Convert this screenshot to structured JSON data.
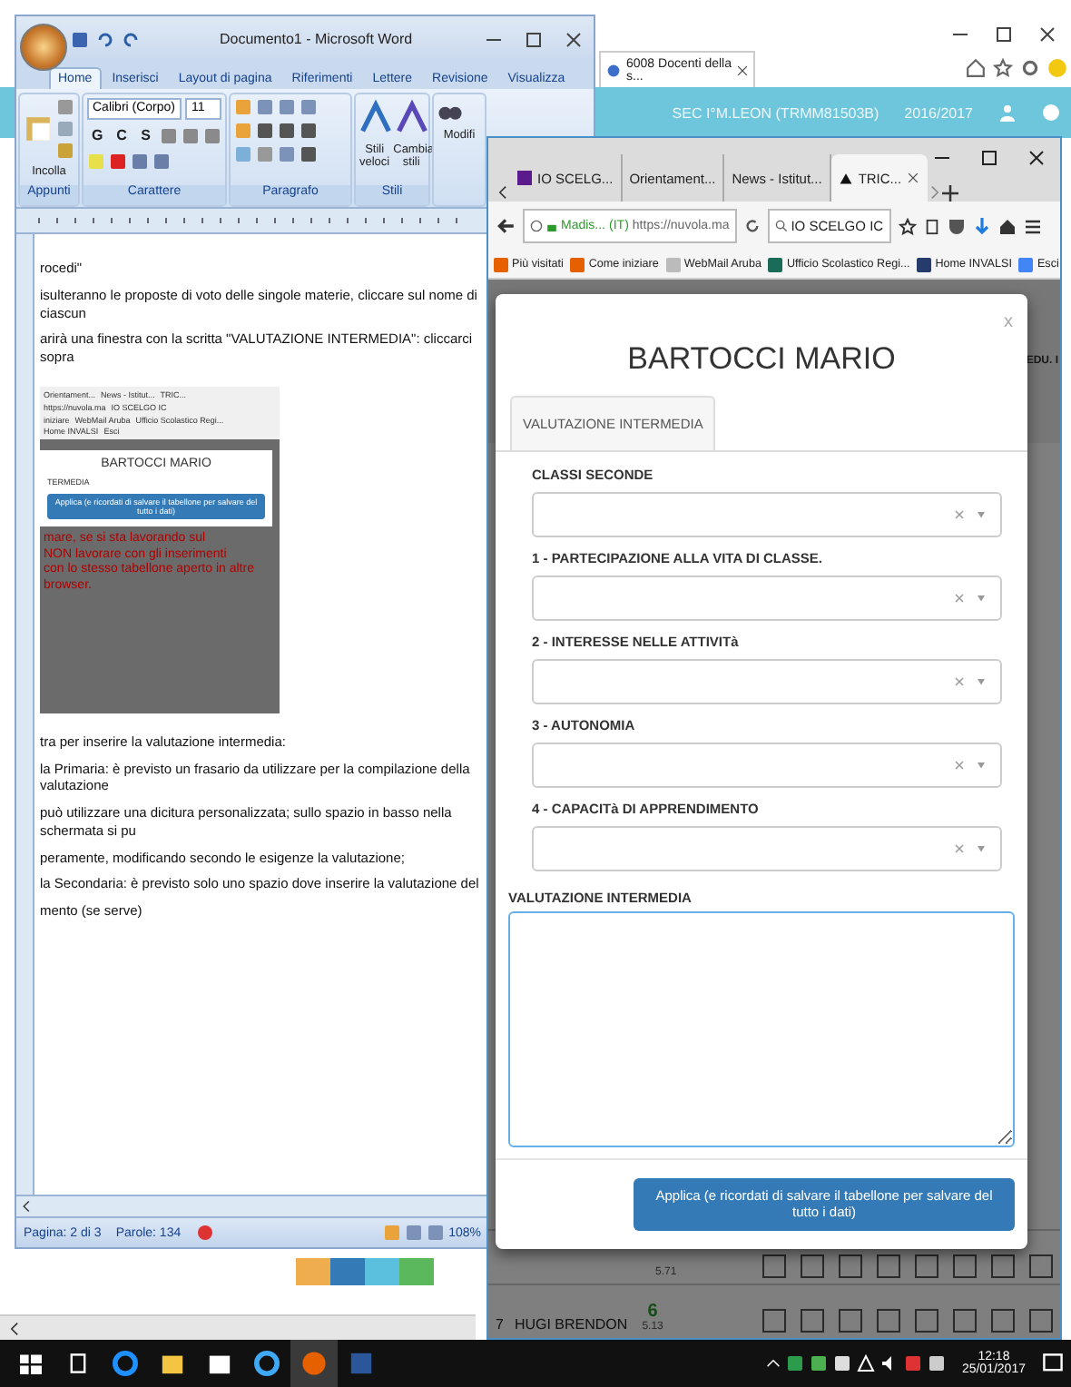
{
  "background_browser": {
    "tab": "6008 Docenti della s...",
    "school": "SEC I°M.LEON (TRMM81503B)",
    "year": "2016/2017"
  },
  "word": {
    "title": "Documento1 - Microsoft Word",
    "ribbon_tabs": [
      {
        "label": "Home",
        "selected": true
      },
      {
        "label": "Inserisci",
        "selected": false
      },
      {
        "label": "Layout di pagina",
        "selected": false
      },
      {
        "label": "Riferimenti",
        "selected": false
      },
      {
        "label": "Lettere",
        "selected": false
      },
      {
        "label": "Revisione",
        "selected": false
      },
      {
        "label": "Visualizza",
        "selected": false
      }
    ],
    "paste": "Incolla",
    "font": "Calibri (Corpo)",
    "size": "11",
    "format_buttons": [
      "G",
      "C",
      "S"
    ],
    "styles": [
      "Stili veloci",
      "Cambia stili"
    ],
    "edit": "Modifi",
    "groups": [
      "Appunti",
      "Carattere",
      "Paragrafo",
      "Stili"
    ],
    "paragraphs_before": [
      "rocedi\"",
      "isulteranno le proposte di voto delle singole materie, cliccare sul nome di ciascun",
      "arirà una finestra con la scritta \"VALUTAZIONE INTERMEDIA\": cliccarci sopra"
    ],
    "embedded": {
      "tabs": [
        "Orientament...",
        "News - Istitut...",
        "TRIC..."
      ],
      "url": "https://nuvola.ma",
      "search": "IO SCELGO IC",
      "bookmarks": [
        "iniziare",
        "WebMail Aruba",
        "Ufficio Scolastico Regi...",
        "Home INVALSI",
        "Esci"
      ],
      "title": "BARTOCCI MARIO",
      "tab": "TERMEDIA",
      "apply": "Applica (e ricordati di salvare il tabellone per salvare del tutto i dati)",
      "warning": [
        "mare, se si sta lavorando sul",
        "NON lavorare con gli inserimenti",
        "con lo stesso tabellone aperto in altre",
        "browser."
      ]
    },
    "paragraphs_after": [
      "tra per inserire la valutazione intermedia:",
      "la Primaria: è previsto un frasario da utilizzare per la compilazione della valutazione",
      "può utilizzare una dicitura personalizzata; sullo spazio in basso nella schermata si pu",
      "peramente, modificando secondo le esigenze la valutazione;",
      "la Secondaria: è previsto solo uno spazio dove inserire la valutazione del",
      "mento (se serve)"
    ],
    "status": {
      "page": "Pagina: 2 di 3",
      "words": "Parole: 134",
      "zoom": "108%"
    }
  },
  "firefox": {
    "tabs": [
      {
        "label": "IO SCELG...",
        "selected": false
      },
      {
        "label": "Orientament...",
        "selected": false
      },
      {
        "label": "News - Istitut...",
        "selected": false
      },
      {
        "label": "TRIC...",
        "selected": true
      }
    ],
    "site": "Madis...",
    "site_country": "(IT)",
    "url": "https://nuvola.ma",
    "search": "IO SCELGO IC",
    "bookmarks": [
      "Più visitati",
      "Come iniziare",
      "WebMail Aruba",
      "Ufficio Scolastico Regi...",
      "Home INVALSI",
      "Esci"
    ],
    "page": {
      "header": "EDU. I",
      "rows": [
        {
          "number": "",
          "name": "",
          "grade": "",
          "average": "5.71",
          "checks": [
            false,
            false,
            false,
            false,
            false,
            false,
            false,
            false
          ]
        },
        {
          "number": "7",
          "name": "HUGI BRENDON",
          "grade": "6",
          "average": "5.13",
          "checks": [
            false,
            false,
            false,
            false,
            false,
            false,
            false,
            false
          ]
        }
      ]
    }
  },
  "modal": {
    "close": "x",
    "title": "BARTOCCI MARIO",
    "tabs": [
      {
        "label": "VALUTAZIONE INTERMEDIA",
        "selected": true
      }
    ],
    "section": "CLASSI SECONDE",
    "fields": [
      "1 - PARTECIPAZIONE ALLA VITA DI CLASSE.",
      "2 - INTERESSE NELLE ATTIVITà",
      "3 - AUTONOMIA",
      "4 - CAPACITà DI APPRENDIMENTO"
    ],
    "textarea_label": "VALUTAZIONE INTERMEDIA",
    "apply": "Applica (e ricordati di salvare il tabellone per salvare del tutto i dati)"
  },
  "taskbar": {
    "time": "12:18",
    "date": "25/01/2017"
  }
}
